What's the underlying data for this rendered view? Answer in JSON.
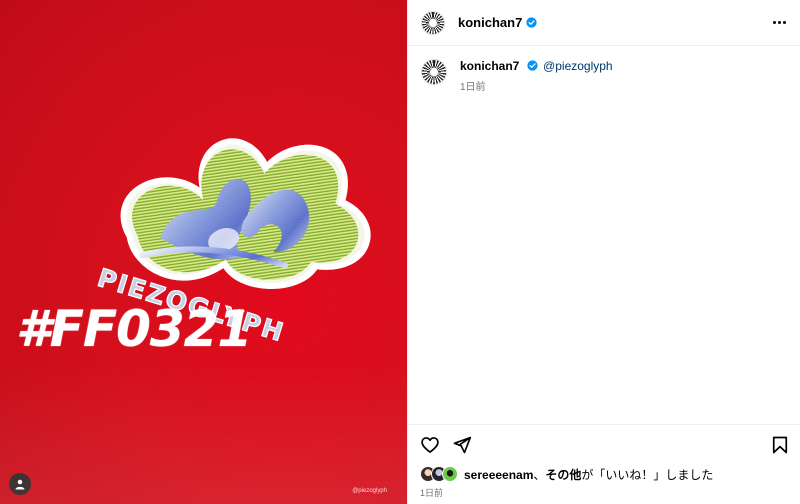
{
  "post": {
    "username": "konichan7",
    "verified": true
  },
  "media": {
    "hashtag": "#FF0321",
    "logo_text": "PIEZOGLYPH",
    "watermark": "@piezoglyph",
    "background_color": "#d4101c"
  },
  "caption": {
    "username": "konichan7",
    "mention": "@piezoglyph",
    "time": "1日前"
  },
  "actions": {
    "like_icon": "heart-icon",
    "share_icon": "paper-plane-icon",
    "save_icon": "bookmark-icon"
  },
  "likes": {
    "first_user": "sereeeenam",
    "separator": "、",
    "others": "その他",
    "suffix": "が「いいね！」しました"
  },
  "footer": {
    "time": "1日前"
  },
  "colors": {
    "accent": "#0095f6",
    "mention": "#00376b",
    "muted": "#737373"
  }
}
